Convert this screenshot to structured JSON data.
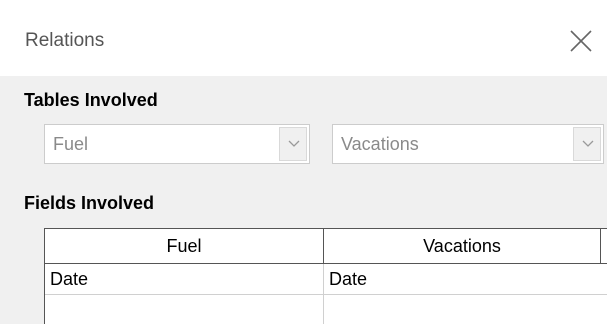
{
  "window": {
    "title": "Relations",
    "close_icon": "close-icon"
  },
  "tables_involved": {
    "heading": "Tables Involved",
    "left_table": "Fuel",
    "right_table": "Vacations"
  },
  "fields_involved": {
    "heading": "Fields Involved",
    "columns": [
      "Fuel",
      "Vacations"
    ],
    "rows": [
      [
        "Date",
        "Date"
      ],
      [
        "",
        ""
      ]
    ]
  },
  "colors": {
    "dialog_background": "#f0f0f0",
    "grid_border": "#555555"
  }
}
